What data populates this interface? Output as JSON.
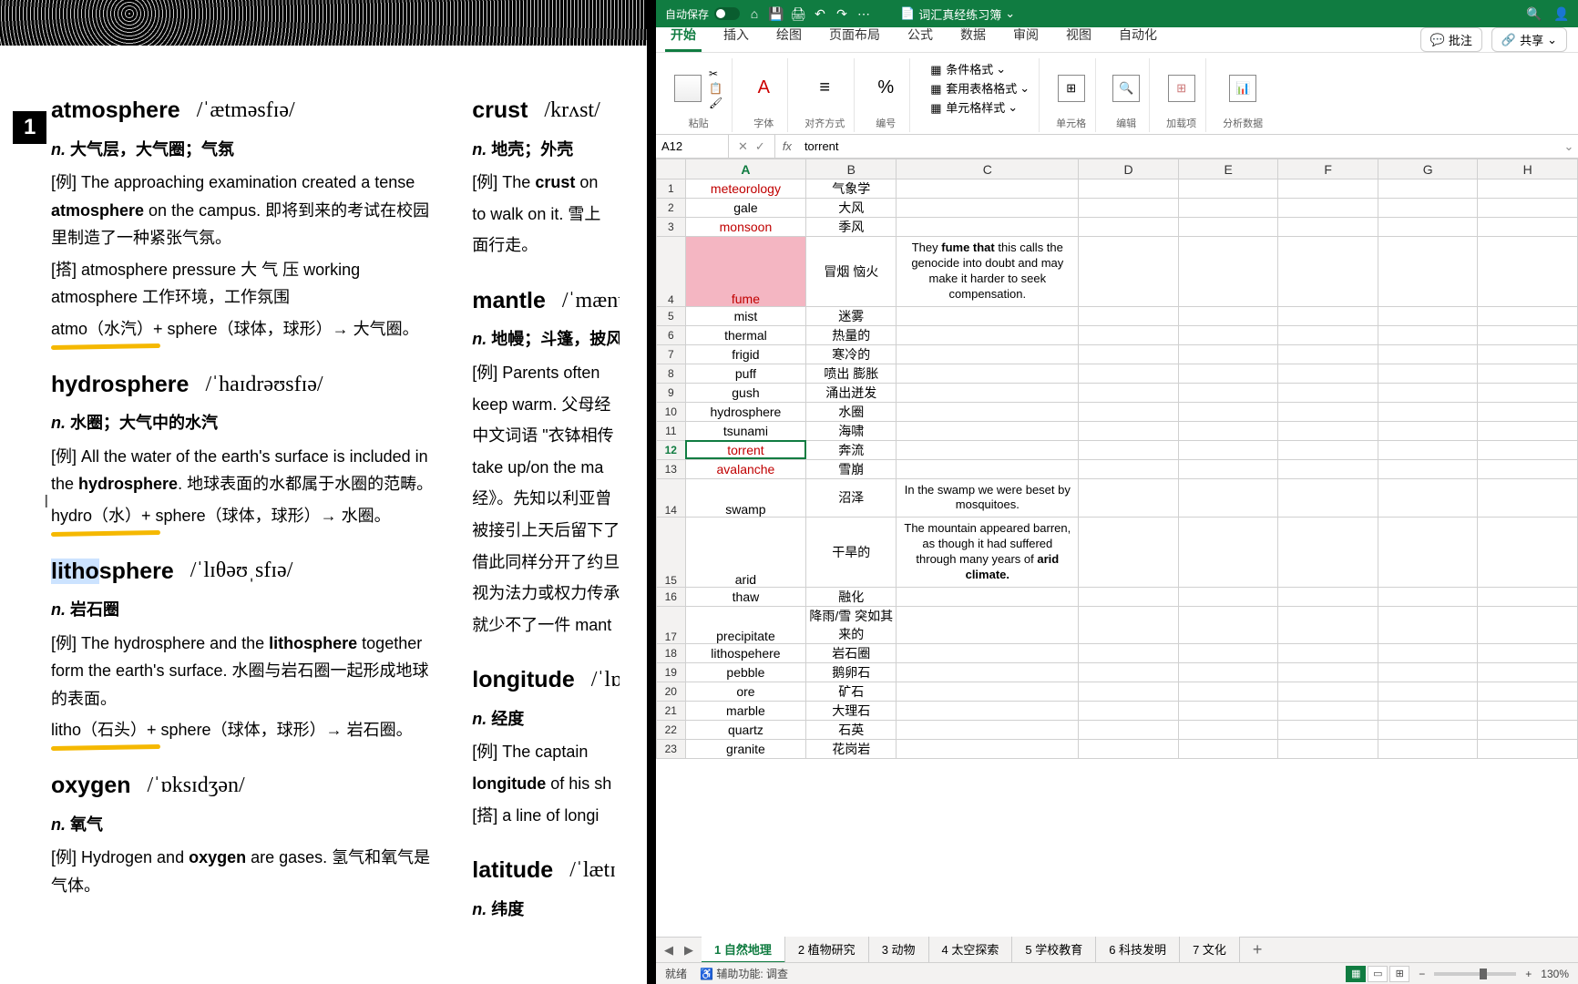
{
  "doc": {
    "page_number": "1",
    "entries_left": [
      {
        "word": "atmosphere",
        "ipa": "/ˈætməsfɪə/",
        "pos": "n.",
        "def": "大气层，大气圈；气氛",
        "ex": "[例] The approaching examination created a tense <b>atmosphere</b> on the campus. 即将到来的考试在校园里制造了一种紧张气氛。",
        "collo": "[搭] atmosphere pressure 大 气 压   working atmosphere 工作环境，工作氛围",
        "etym": "atmo（水汽）+ sphere（球体，球形）→ 大气圈。",
        "ul": true
      },
      {
        "word": "hydrosphere",
        "ipa": "/ˈhaɪdrəʊsfɪə/",
        "pos": "n.",
        "def": "水圈；大气中的水汽",
        "ex": "[例] All the water of the earth's surface is included in the <b>hydrosphere</b>. 地球表面的水都属于水圈的范畴。",
        "etym": "hydro（水）+ sphere（球体，球形）→ 水圈。",
        "ul": true
      },
      {
        "word": "lithosphere",
        "ipa": "/ˈlɪθəʊˌsfɪə/",
        "pos": "n.",
        "def": "岩石圈",
        "ex": "[例] The hydrosphere and the <b>lithosphere</b> together form the earth's surface. 水圈与岩石圈一起形成地球的表面。",
        "etym": "litho（石头）+ sphere（球体，球形）→ 岩石圈。",
        "ul": true,
        "sel": true
      },
      {
        "word": "oxygen",
        "ipa": "/ˈɒksɪdʒən/",
        "pos": "n.",
        "def": "氧气",
        "ex": "[例] Hydrogen and <b>oxygen</b> are gases. 氢气和氧气是气体。"
      }
    ],
    "entries_right": [
      {
        "word": "crust",
        "ipa": "/krʌst/",
        "pos": "n.",
        "def": "地壳；外壳",
        "ex": "[例] The <b>crust</b> on",
        "ex2": "to walk on it. 雪上",
        "ex3": "面行走。"
      },
      {
        "word": "mantle",
        "ipa": "/ˈmænt",
        "pos": "n.",
        "def": "地幔；斗篷，披风",
        "ex": "[例] Parents often",
        "ex2": "keep warm. 父母经",
        "ex3": "中文词语 \"衣钵相传",
        "ex4": "take up/on the ma",
        "ex5": "经》。先知以利亚曾",
        "ex6": "被接引上天后留下了",
        "ex7": "借此同样分开了约旦",
        "ex8": "视为法力或权力传承",
        "ex9": "就少不了一件 mant",
        "ul": true
      },
      {
        "word": "longitude",
        "ipa": "/ˈlɒn",
        "pos": "n.",
        "def": "经度",
        "ex": "[例] The captain",
        "ex2": "<b>longitude</b> of his sh",
        "ex3": "[搭] a line of longi"
      },
      {
        "word": "latitude",
        "ipa": "/ˈlætɪ",
        "pos": "n.",
        "def": "纬度"
      }
    ]
  },
  "excel": {
    "title_autosave": "自动保存",
    "doc_name": "词汇真经练习簿",
    "tabs": [
      "开始",
      "插入",
      "绘图",
      "页面布局",
      "公式",
      "数据",
      "审阅",
      "视图",
      "自动化"
    ],
    "active_tab": 0,
    "comment_btn": "批注",
    "share_btn": "共享",
    "ribbon_groups": {
      "paste": "粘贴",
      "font": "字体",
      "align": "对齐方式",
      "number": "编号",
      "cond_fmt": "条件格式",
      "table_style": "套用表格格式",
      "cell_style": "单元格样式",
      "cells": "单元格",
      "edit": "编辑",
      "addin": "加载项",
      "analyze": "分析数据"
    },
    "namebox": "A12",
    "fx": "fx",
    "formula": "torrent",
    "col_headers": [
      "A",
      "B",
      "C",
      "D",
      "E",
      "F",
      "G",
      "H"
    ],
    "active_col": "A",
    "active_row": 12,
    "rows": [
      {
        "r": 1,
        "a": "meteorology",
        "b": "气象学",
        "red": true
      },
      {
        "r": 2,
        "a": "gale",
        "b": "大风"
      },
      {
        "r": 3,
        "a": "monsoon",
        "b": "季风",
        "red": true
      },
      {
        "r": 4,
        "a": "fume",
        "b": "冒烟 恼火",
        "c": "They <b>fume that</b> this calls the genocide into doubt and may make it harder to seek compensation.",
        "red": true,
        "pink": true,
        "tall": true
      },
      {
        "r": 5,
        "a": "mist",
        "b": "迷雾"
      },
      {
        "r": 6,
        "a": "thermal",
        "b": "热量的"
      },
      {
        "r": 7,
        "a": "frigid",
        "b": "寒冷的"
      },
      {
        "r": 8,
        "a": "puff",
        "b": "喷出 膨胀"
      },
      {
        "r": 9,
        "a": "gush",
        "b": "涌出迸发"
      },
      {
        "r": 10,
        "a": "hydrosphere",
        "b": "水圈"
      },
      {
        "r": 11,
        "a": "tsunami",
        "b": "海啸"
      },
      {
        "r": 12,
        "a": "torrent",
        "b": "奔流",
        "red": true,
        "sel": true
      },
      {
        "r": 13,
        "a": "avalanche",
        "b": "雪崩",
        "red": true
      },
      {
        "r": 14,
        "a": "swamp",
        "b": "沼泽",
        "c": "In the swamp we were beset by mosquitoes.",
        "tall": true
      },
      {
        "r": 15,
        "a": "arid",
        "b": "干旱的",
        "c": "The mountain appeared barren, as though it had suffered through many years of <b>arid climate.</b>",
        "tall": true
      },
      {
        "r": 16,
        "a": "thaw",
        "b": "融化"
      },
      {
        "r": 17,
        "a": "precipitate",
        "b": "降雨/雪 突如其来的",
        "tall": true
      },
      {
        "r": 18,
        "a": "lithospehere",
        "b": "岩石圈"
      },
      {
        "r": 19,
        "a": "pebble",
        "b": "鹅卵石"
      },
      {
        "r": 20,
        "a": "ore",
        "b": "矿石"
      },
      {
        "r": 21,
        "a": "marble",
        "b": "大理石"
      },
      {
        "r": 22,
        "a": "quartz",
        "b": "石英"
      },
      {
        "r": 23,
        "a": "granite",
        "b": "花岗岩"
      }
    ],
    "sheets": [
      "1 自然地理",
      "2 植物研究",
      "3 动物",
      "4 太空探索",
      "5 学校教育",
      "6 科技发明",
      "7 文化"
    ],
    "active_sheet": 0,
    "status_ready": "就绪",
    "status_a11y": "辅助功能: 调查",
    "zoom_pct": "130%"
  }
}
